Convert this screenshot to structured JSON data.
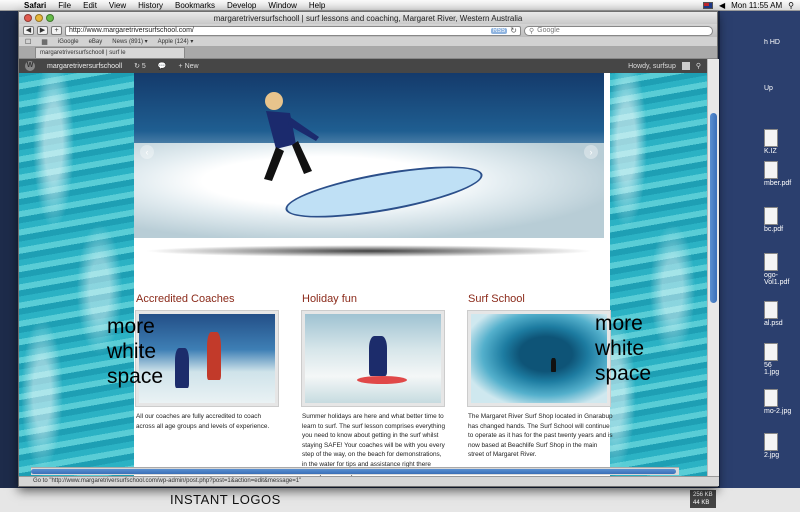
{
  "menubar": {
    "app": "Safari",
    "items": [
      "File",
      "Edit",
      "View",
      "History",
      "Bookmarks",
      "Develop",
      "Window",
      "Help"
    ],
    "clock": "Mon 11:55 AM"
  },
  "window": {
    "title": "margaretriversurfschooll | surf lessons and coaching, Margaret River, Western Australia",
    "url": "http://www.margaretriversurfschool.com/",
    "rss": "RSS",
    "search_placeholder": "Google",
    "bookmarks": [
      "iGoogle",
      "eBay",
      "News (891) ▾",
      "Apple (124) ▾"
    ],
    "tab_label": "margaretriversurfschooll | surf le",
    "status_text": "Go to \"http://www.margaretriversurfschool.com/wp-admin/post.php?post=1&action=edit&message=1\""
  },
  "adminbar": {
    "site_name": "margaretriversurfschooll",
    "updates_count": "5",
    "new_label": "+ New",
    "greeting": "Howdy, surfsup"
  },
  "columns": [
    {
      "heading": "Accredited Coaches",
      "text": "All our coaches are fully accredited to coach across all age groups and levels of experience."
    },
    {
      "heading": "Holiday fun",
      "text": "Summer holidays are here and what better time to learn to surf. The surf lesson comprises everything you need to know about getting in the surf whilst staying SAFE! Your coaches will be with you every step of the way, on the beach for demonstrations, in the water for tips and assistance right there when you 'claim' your first"
    },
    {
      "heading": "Surf School",
      "text": "The Margaret River Surf Shop located in Gnarabup has changed hands. The Surf School will continue to operate as it has for the past twenty years and is now based at Beachlife Surf Shop in the main street of Margaret River."
    }
  ],
  "annotations": {
    "left": "more\nwhite\nspace",
    "right": "more\nwhite\nspace"
  },
  "desktop": {
    "files": [
      "h HD",
      "Up",
      "K.IZ",
      "mber.pdf",
      "bc.pdf",
      "ogo-\nVol1.pdf",
      "al.psd",
      "56\n1.jpg",
      "mo-2.jpg",
      "2.jpg"
    ],
    "bottom_label": "INSTANT LOGOS",
    "size1": "256 KB",
    "size2": "44 KB"
  }
}
